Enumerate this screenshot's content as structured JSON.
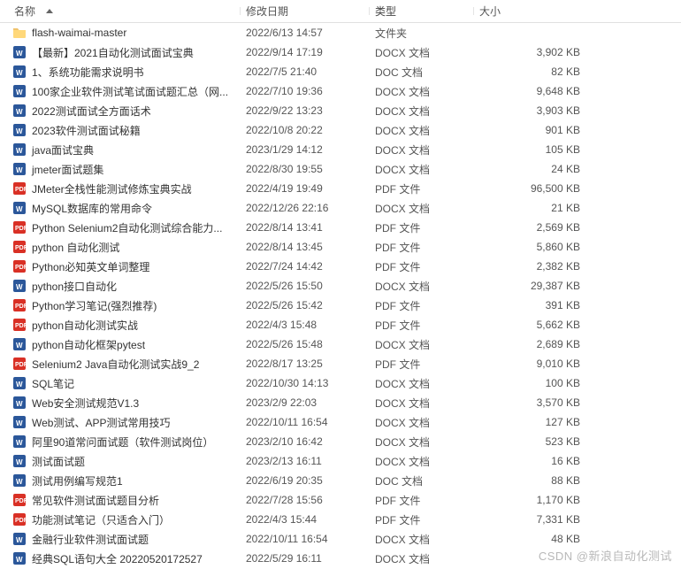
{
  "columns": {
    "name": "名称",
    "date": "修改日期",
    "type": "类型",
    "size": "大小"
  },
  "watermark": "CSDN @新浪自动化测试",
  "rows": [
    {
      "icon": "folder",
      "name": "flash-waimai-master",
      "date": "2022/6/13 14:57",
      "type": "文件夹",
      "size": ""
    },
    {
      "icon": "docx",
      "name": "【最新】2021自动化测试面试宝典",
      "date": "2022/9/14 17:19",
      "type": "DOCX 文档",
      "size": "3,902 KB"
    },
    {
      "icon": "doc",
      "name": "1、系统功能需求说明书",
      "date": "2022/7/5 21:40",
      "type": "DOC 文档",
      "size": "82 KB"
    },
    {
      "icon": "docx",
      "name": "100家企业软件测试笔试面试题汇总（网...",
      "date": "2022/7/10 19:36",
      "type": "DOCX 文档",
      "size": "9,648 KB"
    },
    {
      "icon": "docx",
      "name": "2022测试面试全方面话术",
      "date": "2022/9/22 13:23",
      "type": "DOCX 文档",
      "size": "3,903 KB"
    },
    {
      "icon": "docx",
      "name": "2023软件测试面试秘籍",
      "date": "2022/10/8 20:22",
      "type": "DOCX 文档",
      "size": "901 KB"
    },
    {
      "icon": "docx",
      "name": "java面试宝典",
      "date": "2023/1/29 14:12",
      "type": "DOCX 文档",
      "size": "105 KB"
    },
    {
      "icon": "docx",
      "name": "jmeter面试题集",
      "date": "2022/8/30 19:55",
      "type": "DOCX 文档",
      "size": "24 KB"
    },
    {
      "icon": "pdf",
      "name": "JMeter全栈性能测试修炼宝典实战",
      "date": "2022/4/19 19:49",
      "type": "PDF 文件",
      "size": "96,500 KB"
    },
    {
      "icon": "docx",
      "name": "MySQL数据库的常用命令",
      "date": "2022/12/26 22:16",
      "type": "DOCX 文档",
      "size": "21 KB"
    },
    {
      "icon": "pdf",
      "name": "Python Selenium2自动化测试综合能力...",
      "date": "2022/8/14 13:41",
      "type": "PDF 文件",
      "size": "2,569 KB"
    },
    {
      "icon": "pdf",
      "name": "python 自动化测试",
      "date": "2022/8/14 13:45",
      "type": "PDF 文件",
      "size": "5,860 KB"
    },
    {
      "icon": "pdf",
      "name": "Python必知英文单词整理",
      "date": "2022/7/24 14:42",
      "type": "PDF 文件",
      "size": "2,382 KB"
    },
    {
      "icon": "docx",
      "name": "python接口自动化",
      "date": "2022/5/26 15:50",
      "type": "DOCX 文档",
      "size": "29,387 KB"
    },
    {
      "icon": "pdf",
      "name": "Python学习笔记(强烈推荐)",
      "date": "2022/5/26 15:42",
      "type": "PDF 文件",
      "size": "391 KB"
    },
    {
      "icon": "pdf",
      "name": "python自动化测试实战",
      "date": "2022/4/3 15:48",
      "type": "PDF 文件",
      "size": "5,662 KB"
    },
    {
      "icon": "docx",
      "name": "python自动化框架pytest",
      "date": "2022/5/26 15:48",
      "type": "DOCX 文档",
      "size": "2,689 KB"
    },
    {
      "icon": "pdf",
      "name": "Selenium2 Java自动化测试实战9_2",
      "date": "2022/8/17 13:25",
      "type": "PDF 文件",
      "size": "9,010 KB"
    },
    {
      "icon": "docx",
      "name": "SQL笔记",
      "date": "2022/10/30 14:13",
      "type": "DOCX 文档",
      "size": "100 KB"
    },
    {
      "icon": "docx",
      "name": "Web安全测试规范V1.3",
      "date": "2023/2/9 22:03",
      "type": "DOCX 文档",
      "size": "3,570 KB"
    },
    {
      "icon": "docx",
      "name": "Web测试、APP测试常用技巧",
      "date": "2022/10/11 16:54",
      "type": "DOCX 文档",
      "size": "127 KB"
    },
    {
      "icon": "docx",
      "name": "阿里90道常问面试题（软件测试岗位）",
      "date": "2023/2/10 16:42",
      "type": "DOCX 文档",
      "size": "523 KB"
    },
    {
      "icon": "docx",
      "name": "测试面试题",
      "date": "2023/2/13 16:11",
      "type": "DOCX 文档",
      "size": "16 KB"
    },
    {
      "icon": "doc",
      "name": "测试用例编写规范1",
      "date": "2022/6/19 20:35",
      "type": "DOC 文档",
      "size": "88 KB"
    },
    {
      "icon": "pdf",
      "name": "常见软件测试面试题目分析",
      "date": "2022/7/28 15:56",
      "type": "PDF 文件",
      "size": "1,170 KB"
    },
    {
      "icon": "pdf",
      "name": "功能测试笔记（只适合入门）",
      "date": "2022/4/3 15:44",
      "type": "PDF 文件",
      "size": "7,331 KB"
    },
    {
      "icon": "docx",
      "name": "金融行业软件测试面试题",
      "date": "2022/10/11 16:54",
      "type": "DOCX 文档",
      "size": "48 KB"
    },
    {
      "icon": "docx",
      "name": "经典SQL语句大全  20220520172527",
      "date": "2022/5/29 16:11",
      "type": "DOCX 文档",
      "size": ""
    }
  ]
}
